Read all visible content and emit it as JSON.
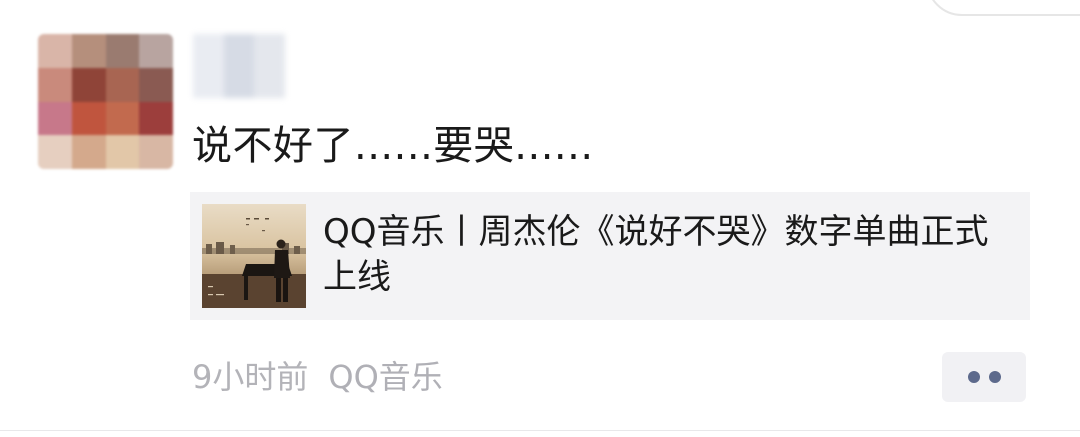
{
  "post": {
    "text": "说不好了......要哭......",
    "share": {
      "title": "QQ音乐丨周杰伦《说好不哭》数字单曲正式上线"
    },
    "time": "9小时前",
    "source": "QQ音乐"
  }
}
